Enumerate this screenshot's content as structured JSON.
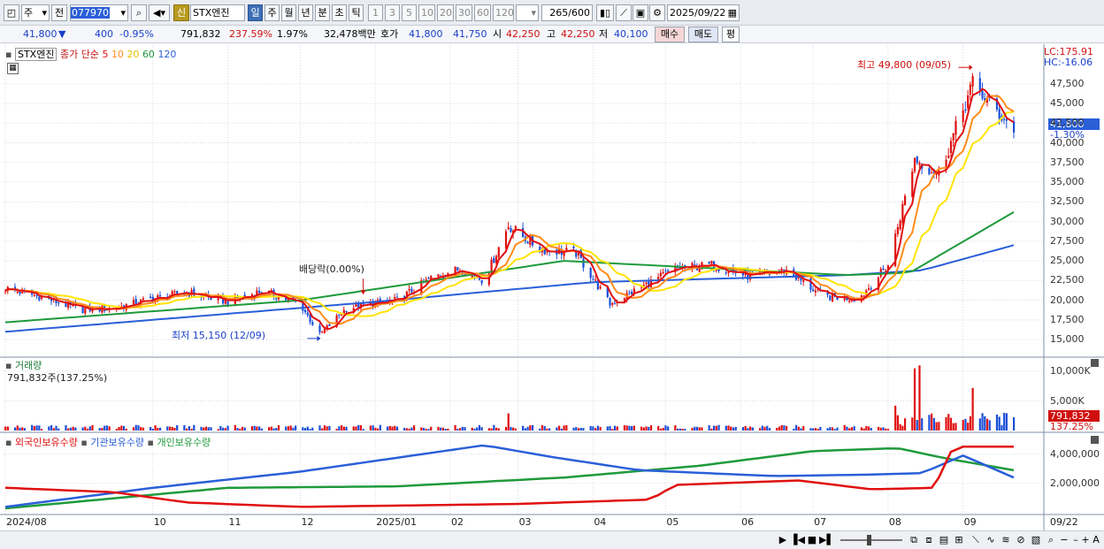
{
  "toolbar": {
    "period_label": "주",
    "prev_label": "전",
    "code": "077970",
    "badge": "신",
    "stock_name": "STX엔진",
    "intervals": [
      "일",
      "주",
      "월",
      "년",
      "분",
      "초",
      "틱"
    ],
    "active_interval": "일",
    "minutes": [
      "1",
      "3",
      "5",
      "10",
      "20",
      "30",
      "60",
      "120"
    ],
    "count": "265",
    "count_total": "/600",
    "date": "2025/09/22"
  },
  "quote": {
    "price": "41,800",
    "change": "400",
    "change_pct": "-0.95%",
    "volume": "791,832",
    "volume_ratio": "237.59%",
    "turnover": "1.97%",
    "amount": "32,478백만",
    "hoga_label": "호가",
    "ask": "41,800",
    "bid": "41,750",
    "open_label": "시",
    "open": "42,250",
    "high_label": "고",
    "high": "42,250",
    "low_label": "저",
    "low": "40,100",
    "buy_label": "매수",
    "sell_label": "매도",
    "eval_label": "평"
  },
  "price_panel": {
    "name_tag": "STX엔진",
    "legend_prefix": "종가 단순",
    "ma": [
      {
        "period": "5",
        "color": "#e01010"
      },
      {
        "period": "10",
        "color": "#ff8c1a"
      },
      {
        "period": "20",
        "color": "#e8d000"
      },
      {
        "period": "60",
        "color": "#1f9a3c"
      },
      {
        "period": "120",
        "color": "#2a5fd8"
      }
    ],
    "lc": "LC:175.91",
    "hc": "HC:-16.06",
    "current_price": "41,800",
    "current_pct": "-1.30%",
    "annotation_high": "최고 49,800 (09/05)",
    "annotation_low": "최저 15,150 (12/09)",
    "annotation_div": "배당락(0.00%)"
  },
  "volume_panel": {
    "title": "거래량",
    "value": "791,832주(137.25%)",
    "current": "791,832",
    "current_pct": "137.25%"
  },
  "holdings_panel": {
    "series": [
      {
        "name": "외국인보유수량",
        "color": "#e01010"
      },
      {
        "name": "기관보유수량",
        "color": "#2a5fd8"
      },
      {
        "name": "개인보유수량",
        "color": "#1f9a3c"
      }
    ]
  },
  "x_axis": {
    "labels": [
      "2024/08",
      "10",
      "11",
      "12",
      "2025/01",
      "02",
      "03",
      "04",
      "05",
      "06",
      "07",
      "08",
      "09"
    ],
    "right_date": "09/22"
  },
  "chart_data": [
    {
      "type": "candlestick",
      "title": "STX엔진",
      "ylim": [
        13000,
        50500
      ],
      "y_ticks": [
        15000,
        17500,
        20000,
        22500,
        25000,
        27500,
        30000,
        32500,
        35000,
        37500,
        40000,
        42500,
        45000,
        47500
      ],
      "y_tick_labels": [
        "15,000",
        "17,500",
        "20,000",
        "22,500",
        "25,000",
        "27,500",
        "30,000",
        "32,500",
        "35,000",
        "37,500",
        "40,000",
        "42,500",
        "45,000",
        "47,500"
      ],
      "close_series": [
        [
          "2024-08-01",
          21500
        ],
        [
          "2024-08-15",
          20500
        ],
        [
          "2024-09-01",
          18800
        ],
        [
          "2024-09-15",
          19000
        ],
        [
          "2024-10-01",
          20200
        ],
        [
          "2024-10-15",
          21000
        ],
        [
          "2024-11-01",
          19800
        ],
        [
          "2024-11-15",
          21200
        ],
        [
          "2024-12-01",
          19500
        ],
        [
          "2024-12-09",
          15600
        ],
        [
          "2024-12-20",
          19000
        ],
        [
          "2025-01-10",
          20000
        ],
        [
          "2025-01-25",
          23000
        ],
        [
          "2025-02-05",
          24000
        ],
        [
          "2025-02-15",
          22500
        ],
        [
          "2025-02-25",
          29500
        ],
        [
          "2025-03-10",
          26500
        ],
        [
          "2025-03-25",
          26000
        ],
        [
          "2025-04-08",
          19500
        ],
        [
          "2025-04-20",
          21500
        ],
        [
          "2025-05-05",
          24000
        ],
        [
          "2025-05-20",
          24500
        ],
        [
          "2025-06-05",
          23000
        ],
        [
          "2025-06-20",
          23800
        ],
        [
          "2025-07-05",
          20500
        ],
        [
          "2025-07-20",
          20200
        ],
        [
          "2025-08-01",
          24500
        ],
        [
          "2025-08-12",
          38000
        ],
        [
          "2025-08-22",
          36000
        ],
        [
          "2025-09-05",
          47500
        ],
        [
          "2025-09-15",
          44000
        ],
        [
          "2025-09-22",
          41800
        ]
      ],
      "ma120": [
        [
          "2024-08-01",
          16000
        ],
        [
          "2025-01-01",
          19800
        ],
        [
          "2025-04-01",
          22300
        ],
        [
          "2025-07-15",
          23200
        ],
        [
          "2025-08-15",
          23800
        ],
        [
          "2025-09-22",
          27000
        ]
      ],
      "ma60": [
        [
          "2024-08-01",
          17200
        ],
        [
          "2024-12-01",
          20000
        ],
        [
          "2025-03-20",
          25000
        ],
        [
          "2025-07-15",
          23200
        ],
        [
          "2025-08-10",
          23500
        ],
        [
          "2025-09-22",
          31200
        ]
      ],
      "annotations": [
        {
          "label": "최고 49,800 (09/05)",
          "date": "2025-09-05",
          "value": 49800
        },
        {
          "label": "최저 15,150 (12/09)",
          "date": "2024-12-09",
          "value": 15150
        },
        {
          "label": "배당락(0.00%)",
          "date": "2024-12-27",
          "value": 20500
        }
      ]
    },
    {
      "type": "bar",
      "title": "거래량",
      "y_tick_labels": [
        "5,000K",
        "10,000K"
      ],
      "ylim": [
        0,
        11500000
      ],
      "peaks": [
        [
          "2025-08-12",
          10500000
        ],
        [
          "2025-08-14",
          11000000
        ],
        [
          "2025-09-05",
          7200000
        ],
        [
          "2025-08-04",
          4200000
        ],
        [
          "2025-02-25",
          2900000
        ],
        [
          "2025-05-10",
          2800000
        ]
      ]
    },
    {
      "type": "line",
      "y_tick_labels": [
        "2,000,000",
        "4,000,000"
      ],
      "ylim": [
        0,
        5000000
      ],
      "series": [
        {
          "name": "외국인보유수량",
          "points": [
            [
              "2024-08-01",
              1700000
            ],
            [
              "2024-09-15",
              1400000
            ],
            [
              "2024-10-15",
              700000
            ],
            [
              "2024-12-01",
              400000
            ],
            [
              "2025-03-01",
              600000
            ],
            [
              "2025-04-25",
              900000
            ],
            [
              "2025-05-05",
              1900000
            ],
            [
              "2025-06-25",
              2200000
            ],
            [
              "2025-07-25",
              1600000
            ],
            [
              "2025-08-20",
              1700000
            ],
            [
              "2025-08-28",
              4500000
            ],
            [
              "2025-09-22",
              4500000
            ]
          ]
        },
        {
          "name": "기관보유수량",
          "points": [
            [
              "2024-08-01",
              400000
            ],
            [
              "2024-10-01",
              1700000
            ],
            [
              "2024-12-01",
              2800000
            ],
            [
              "2025-02-15",
              4600000
            ],
            [
              "2025-03-15",
              3800000
            ],
            [
              "2025-04-20",
              2900000
            ],
            [
              "2025-06-15",
              2500000
            ],
            [
              "2025-07-25",
              2600000
            ],
            [
              "2025-08-15",
              2700000
            ],
            [
              "2025-09-01",
              3900000
            ],
            [
              "2025-09-22",
              2400000
            ]
          ]
        },
        {
          "name": "개인보유수량",
          "points": [
            [
              "2024-08-01",
              300000
            ],
            [
              "2024-11-01",
              1700000
            ],
            [
              "2025-01-10",
              1800000
            ],
            [
              "2025-03-20",
              2400000
            ],
            [
              "2025-05-15",
              3200000
            ],
            [
              "2025-07-01",
              4200000
            ],
            [
              "2025-08-05",
              4400000
            ],
            [
              "2025-08-25",
              3700000
            ],
            [
              "2025-09-22",
              2900000
            ]
          ]
        }
      ]
    }
  ]
}
